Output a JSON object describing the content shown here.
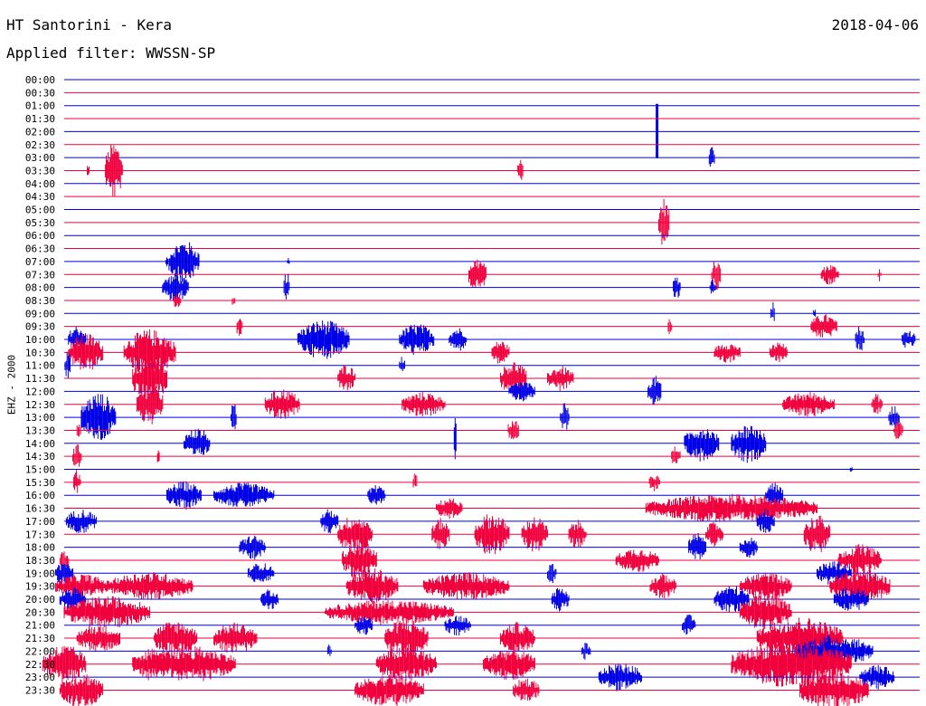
{
  "header": {
    "title": "HT Santorini - Kera",
    "date": "2018-04-06",
    "filter": "Applied filter: WWSSN-SP"
  },
  "side_label": "EHZ - 2000",
  "colors": {
    "blue": "#0000e6",
    "red": "#f0003c"
  },
  "chart_data": {
    "type": "helicorder",
    "station": "HT Santorini - Kera",
    "channel": "EHZ - 2000",
    "date": "2018-04-06",
    "filter": "WWSSN-SP",
    "row_minutes": 30,
    "rows": [
      {
        "label": "00:00",
        "color": "blue",
        "bursts": []
      },
      {
        "label": "00:30",
        "color": "red",
        "bursts": []
      },
      {
        "label": "01:00",
        "color": "blue",
        "bursts": [
          {
            "t": 0.693,
            "w": 0.002,
            "a": 58,
            "asym": "down"
          }
        ]
      },
      {
        "label": "01:30",
        "color": "red",
        "bursts": []
      },
      {
        "label": "02:00",
        "color": "blue",
        "bursts": []
      },
      {
        "label": "02:30",
        "color": "red",
        "bursts": []
      },
      {
        "label": "03:00",
        "color": "blue",
        "bursts": [
          {
            "t": 0.757,
            "w": 0.006,
            "a": 14
          }
        ]
      },
      {
        "label": "03:30",
        "color": "red",
        "bursts": [
          {
            "t": 0.028,
            "w": 0.002,
            "a": 8
          },
          {
            "t": 0.058,
            "w": 0.02,
            "a": 32
          },
          {
            "t": 0.533,
            "w": 0.006,
            "a": 14
          }
        ]
      },
      {
        "label": "04:00",
        "color": "blue",
        "bursts": []
      },
      {
        "label": "04:30",
        "color": "red",
        "bursts": []
      },
      {
        "label": "05:00",
        "color": "blue",
        "bursts": []
      },
      {
        "label": "05:30",
        "color": "red",
        "bursts": [
          {
            "t": 0.701,
            "w": 0.012,
            "a": 28
          }
        ]
      },
      {
        "label": "06:00",
        "color": "blue",
        "bursts": []
      },
      {
        "label": "06:30",
        "color": "red",
        "bursts": []
      },
      {
        "label": "07:00",
        "color": "blue",
        "bursts": [
          {
            "t": 0.12,
            "w": 0.002,
            "a": 6
          },
          {
            "t": 0.14,
            "w": 0.035,
            "a": 24
          },
          {
            "t": 0.262,
            "w": 0.002,
            "a": 4
          }
        ]
      },
      {
        "label": "07:30",
        "color": "red",
        "bursts": [
          {
            "t": 0.483,
            "w": 0.02,
            "a": 20
          },
          {
            "t": 0.762,
            "w": 0.01,
            "a": 18
          },
          {
            "t": 0.895,
            "w": 0.02,
            "a": 12
          },
          {
            "t": 0.953,
            "w": 0.003,
            "a": 8
          }
        ]
      },
      {
        "label": "08:00",
        "color": "blue",
        "bursts": [
          {
            "t": 0.13,
            "w": 0.03,
            "a": 16
          },
          {
            "t": 0.26,
            "w": 0.006,
            "a": 18
          },
          {
            "t": 0.716,
            "w": 0.008,
            "a": 14
          },
          {
            "t": 0.758,
            "w": 0.006,
            "a": 12
          }
        ]
      },
      {
        "label": "08:30",
        "color": "red",
        "bursts": [
          {
            "t": 0.132,
            "w": 0.008,
            "a": 10
          },
          {
            "t": 0.198,
            "w": 0.003,
            "a": 8
          }
        ]
      },
      {
        "label": "09:00",
        "color": "blue",
        "bursts": [
          {
            "t": 0.828,
            "w": 0.004,
            "a": 14
          },
          {
            "t": 0.877,
            "w": 0.002,
            "a": 6
          }
        ]
      },
      {
        "label": "09:30",
        "color": "red",
        "bursts": [
          {
            "t": 0.205,
            "w": 0.006,
            "a": 14
          },
          {
            "t": 0.708,
            "w": 0.004,
            "a": 10
          },
          {
            "t": 0.888,
            "w": 0.03,
            "a": 14
          }
        ]
      },
      {
        "label": "10:00",
        "color": "blue",
        "bursts": [
          {
            "t": 0.015,
            "w": 0.02,
            "a": 16
          },
          {
            "t": 0.303,
            "w": 0.06,
            "a": 22
          },
          {
            "t": 0.412,
            "w": 0.04,
            "a": 18
          },
          {
            "t": 0.46,
            "w": 0.02,
            "a": 14
          },
          {
            "t": 0.93,
            "w": 0.01,
            "a": 16
          },
          {
            "t": 0.987,
            "w": 0.015,
            "a": 12
          }
        ]
      },
      {
        "label": "10:30",
        "color": "red",
        "bursts": [
          {
            "t": 0.025,
            "w": 0.04,
            "a": 22
          },
          {
            "t": 0.1,
            "w": 0.06,
            "a": 26
          },
          {
            "t": 0.51,
            "w": 0.02,
            "a": 14
          },
          {
            "t": 0.775,
            "w": 0.03,
            "a": 12
          },
          {
            "t": 0.835,
            "w": 0.02,
            "a": 12
          }
        ]
      },
      {
        "label": "11:00",
        "color": "blue",
        "bursts": [
          {
            "t": 0.004,
            "w": 0.006,
            "a": 16
          },
          {
            "t": 0.395,
            "w": 0.006,
            "a": 10
          }
        ]
      },
      {
        "label": "11:30",
        "color": "red",
        "bursts": [
          {
            "t": 0.1,
            "w": 0.04,
            "a": 28
          },
          {
            "t": 0.33,
            "w": 0.02,
            "a": 16
          },
          {
            "t": 0.525,
            "w": 0.03,
            "a": 20
          },
          {
            "t": 0.58,
            "w": 0.03,
            "a": 14
          }
        ]
      },
      {
        "label": "12:00",
        "color": "blue",
        "bursts": [
          {
            "t": 0.535,
            "w": 0.03,
            "a": 12
          },
          {
            "t": 0.69,
            "w": 0.015,
            "a": 18
          }
        ]
      },
      {
        "label": "12:30",
        "color": "red",
        "bursts": [
          {
            "t": 0.1,
            "w": 0.03,
            "a": 24
          },
          {
            "t": 0.255,
            "w": 0.04,
            "a": 18
          },
          {
            "t": 0.42,
            "w": 0.05,
            "a": 14
          },
          {
            "t": 0.87,
            "w": 0.06,
            "a": 14
          },
          {
            "t": 0.95,
            "w": 0.012,
            "a": 12
          }
        ]
      },
      {
        "label": "13:00",
        "color": "blue",
        "bursts": [
          {
            "t": 0.04,
            "w": 0.04,
            "a": 28
          },
          {
            "t": 0.198,
            "w": 0.006,
            "a": 20
          },
          {
            "t": 0.585,
            "w": 0.01,
            "a": 16
          },
          {
            "t": 0.97,
            "w": 0.012,
            "a": 14
          }
        ]
      },
      {
        "label": "13:30",
        "color": "red",
        "bursts": [
          {
            "t": 0.525,
            "w": 0.012,
            "a": 14
          },
          {
            "t": 0.975,
            "w": 0.01,
            "a": 12
          },
          {
            "t": 0.017,
            "w": 0.004,
            "a": 10
          }
        ]
      },
      {
        "label": "14:00",
        "color": "blue",
        "bursts": [
          {
            "t": 0.155,
            "w": 0.03,
            "a": 18
          },
          {
            "t": 0.745,
            "w": 0.04,
            "a": 20
          },
          {
            "t": 0.8,
            "w": 0.04,
            "a": 22
          },
          {
            "t": 0.457,
            "w": 0.002,
            "a": 34
          }
        ]
      },
      {
        "label": "14:30",
        "color": "red",
        "bursts": [
          {
            "t": 0.015,
            "w": 0.01,
            "a": 14
          },
          {
            "t": 0.11,
            "w": 0.002,
            "a": 10
          },
          {
            "t": 0.715,
            "w": 0.01,
            "a": 12
          }
        ]
      },
      {
        "label": "15:00",
        "color": "blue",
        "bursts": [
          {
            "t": 0.92,
            "w": 0.002,
            "a": 4
          }
        ]
      },
      {
        "label": "15:30",
        "color": "red",
        "bursts": [
          {
            "t": 0.015,
            "w": 0.008,
            "a": 14
          },
          {
            "t": 0.41,
            "w": 0.004,
            "a": 12
          },
          {
            "t": 0.69,
            "w": 0.012,
            "a": 10
          }
        ]
      },
      {
        "label": "16:00",
        "color": "blue",
        "bursts": [
          {
            "t": 0.14,
            "w": 0.04,
            "a": 16
          },
          {
            "t": 0.21,
            "w": 0.07,
            "a": 14
          },
          {
            "t": 0.365,
            "w": 0.02,
            "a": 12
          },
          {
            "t": 0.83,
            "w": 0.02,
            "a": 14
          }
        ]
      },
      {
        "label": "16:30",
        "color": "red",
        "bursts": [
          {
            "t": 0.45,
            "w": 0.03,
            "a": 12
          },
          {
            "t": 0.78,
            "w": 0.2,
            "a": 16
          }
        ]
      },
      {
        "label": "17:00",
        "color": "blue",
        "bursts": [
          {
            "t": 0.02,
            "w": 0.035,
            "a": 14
          },
          {
            "t": 0.31,
            "w": 0.02,
            "a": 14
          },
          {
            "t": 0.82,
            "w": 0.02,
            "a": 14
          }
        ]
      },
      {
        "label": "17:30",
        "color": "red",
        "bursts": [
          {
            "t": 0.34,
            "w": 0.04,
            "a": 22
          },
          {
            "t": 0.44,
            "w": 0.02,
            "a": 18
          },
          {
            "t": 0.5,
            "w": 0.04,
            "a": 24
          },
          {
            "t": 0.55,
            "w": 0.03,
            "a": 20
          },
          {
            "t": 0.6,
            "w": 0.02,
            "a": 16
          },
          {
            "t": 0.76,
            "w": 0.02,
            "a": 14
          },
          {
            "t": 0.88,
            "w": 0.03,
            "a": 22
          }
        ]
      },
      {
        "label": "18:00",
        "color": "blue",
        "bursts": [
          {
            "t": 0.22,
            "w": 0.03,
            "a": 14
          },
          {
            "t": 0.74,
            "w": 0.02,
            "a": 16
          },
          {
            "t": 0.8,
            "w": 0.02,
            "a": 12
          }
        ]
      },
      {
        "label": "18:30",
        "color": "red",
        "bursts": [
          {
            "t": 0.0,
            "w": 0.01,
            "a": 12
          },
          {
            "t": 0.345,
            "w": 0.04,
            "a": 22
          },
          {
            "t": 0.67,
            "w": 0.05,
            "a": 14
          },
          {
            "t": 0.93,
            "w": 0.05,
            "a": 18
          }
        ]
      },
      {
        "label": "19:00",
        "color": "blue",
        "bursts": [
          {
            "t": 0.0,
            "w": 0.02,
            "a": 14
          },
          {
            "t": 0.23,
            "w": 0.03,
            "a": 12
          },
          {
            "t": 0.57,
            "w": 0.01,
            "a": 12
          },
          {
            "t": 0.9,
            "w": 0.04,
            "a": 14
          }
        ]
      },
      {
        "label": "19:30",
        "color": "red",
        "bursts": [
          {
            "t": 0.02,
            "w": 0.06,
            "a": 14
          },
          {
            "t": 0.1,
            "w": 0.1,
            "a": 16
          },
          {
            "t": 0.36,
            "w": 0.06,
            "a": 20
          },
          {
            "t": 0.47,
            "w": 0.1,
            "a": 16
          },
          {
            "t": 0.7,
            "w": 0.03,
            "a": 14
          },
          {
            "t": 0.82,
            "w": 0.06,
            "a": 16
          },
          {
            "t": 0.93,
            "w": 0.07,
            "a": 20
          }
        ]
      },
      {
        "label": "20:00",
        "color": "blue",
        "bursts": [
          {
            "t": 0.01,
            "w": 0.03,
            "a": 14
          },
          {
            "t": 0.24,
            "w": 0.02,
            "a": 12
          },
          {
            "t": 0.58,
            "w": 0.02,
            "a": 14
          },
          {
            "t": 0.78,
            "w": 0.04,
            "a": 16
          },
          {
            "t": 0.92,
            "w": 0.04,
            "a": 14
          }
        ]
      },
      {
        "label": "20:30",
        "color": "red",
        "bursts": [
          {
            "t": 0.05,
            "w": 0.1,
            "a": 18
          },
          {
            "t": 0.38,
            "w": 0.15,
            "a": 14
          },
          {
            "t": 0.82,
            "w": 0.06,
            "a": 20
          }
        ]
      },
      {
        "label": "21:00",
        "color": "blue",
        "bursts": [
          {
            "t": 0.35,
            "w": 0.02,
            "a": 12
          },
          {
            "t": 0.46,
            "w": 0.03,
            "a": 12
          },
          {
            "t": 0.73,
            "w": 0.015,
            "a": 12
          }
        ]
      },
      {
        "label": "21:30",
        "color": "red",
        "bursts": [
          {
            "t": 0.04,
            "w": 0.05,
            "a": 16
          },
          {
            "t": 0.13,
            "w": 0.05,
            "a": 20
          },
          {
            "t": 0.2,
            "w": 0.05,
            "a": 18
          },
          {
            "t": 0.4,
            "w": 0.05,
            "a": 22
          },
          {
            "t": 0.53,
            "w": 0.04,
            "a": 18
          },
          {
            "t": 0.86,
            "w": 0.1,
            "a": 24
          }
        ]
      },
      {
        "label": "22:00",
        "color": "blue",
        "bursts": [
          {
            "t": 0.31,
            "w": 0.004,
            "a": 8
          },
          {
            "t": 0.61,
            "w": 0.01,
            "a": 10
          },
          {
            "t": 0.9,
            "w": 0.09,
            "a": 18
          }
        ]
      },
      {
        "label": "22:30",
        "color": "red",
        "bursts": [
          {
            "t": 0.0,
            "w": 0.05,
            "a": 22
          },
          {
            "t": 0.1,
            "w": 0.04,
            "a": 18
          },
          {
            "t": 0.15,
            "w": 0.1,
            "a": 20
          },
          {
            "t": 0.4,
            "w": 0.07,
            "a": 20
          },
          {
            "t": 0.52,
            "w": 0.06,
            "a": 18
          },
          {
            "t": 0.85,
            "w": 0.14,
            "a": 26
          }
        ]
      },
      {
        "label": "23:00",
        "color": "blue",
        "bursts": [
          {
            "t": 0.65,
            "w": 0.05,
            "a": 16
          },
          {
            "t": 0.95,
            "w": 0.04,
            "a": 14
          }
        ]
      },
      {
        "label": "23:30",
        "color": "red",
        "bursts": [
          {
            "t": 0.02,
            "w": 0.05,
            "a": 20
          },
          {
            "t": 0.38,
            "w": 0.08,
            "a": 18
          },
          {
            "t": 0.54,
            "w": 0.03,
            "a": 14
          },
          {
            "t": 0.9,
            "w": 0.08,
            "a": 22
          }
        ]
      }
    ]
  }
}
